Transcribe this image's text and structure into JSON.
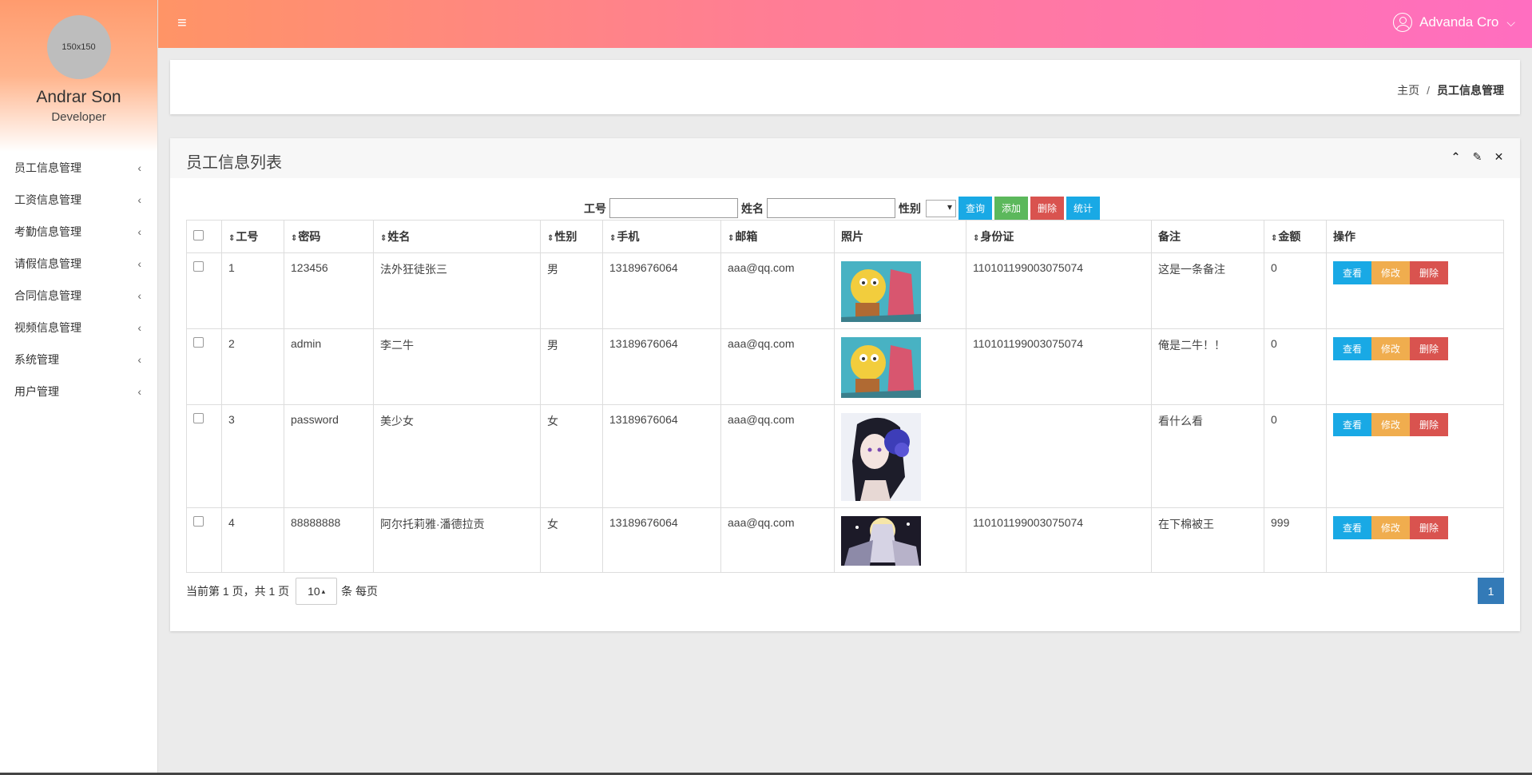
{
  "profile": {
    "avatar_text": "150x150",
    "name": "Andrar Son",
    "role": "Developer"
  },
  "sidebar": {
    "items": [
      {
        "label": "员工信息管理"
      },
      {
        "label": "工资信息管理"
      },
      {
        "label": "考勤信息管理"
      },
      {
        "label": "请假信息管理"
      },
      {
        "label": "合同信息管理"
      },
      {
        "label": "视频信息管理"
      },
      {
        "label": "系统管理"
      },
      {
        "label": "用户管理"
      }
    ],
    "chevron": "‹"
  },
  "topbar": {
    "menu_icon": "≡",
    "user_name": "Advanda Cro",
    "caret": "⌵"
  },
  "breadcrumb": {
    "home": "主页",
    "separator": "/",
    "current": "员工信息管理"
  },
  "panel": {
    "title": "员工信息列表",
    "tools": [
      "⌃",
      "✎",
      "✕"
    ]
  },
  "search": {
    "id_label": "工号",
    "name_label": "姓名",
    "sex_label": "性别",
    "buttons": {
      "query": "查询",
      "add": "添加",
      "delete": "删除",
      "stats": "统计"
    }
  },
  "table": {
    "headers": [
      "工号",
      "密码",
      "姓名",
      "性别",
      "手机",
      "邮箱",
      "照片",
      "身份证",
      "备注",
      "金额",
      "操作"
    ],
    "sort_icon": "⇕",
    "rows": [
      {
        "id": "1",
        "password": "123456",
        "name": "法外狂徒张三",
        "sex": "男",
        "phone": "13189676064",
        "email": "aaa@qq.com",
        "idcard": "110101199003075074",
        "remark": "这是一条备注",
        "amount": "0"
      },
      {
        "id": "2",
        "password": "admin",
        "name": "李二牛",
        "sex": "男",
        "phone": "13189676064",
        "email": "aaa@qq.com",
        "idcard": "110101199003075074",
        "remark": "俺是二牛！！",
        "amount": "0"
      },
      {
        "id": "3",
        "password": "password",
        "name": "美少女",
        "sex": "女",
        "phone": "13189676064",
        "email": "aaa@qq.com",
        "idcard": "",
        "remark": "看什么看",
        "amount": "0"
      },
      {
        "id": "4",
        "password": "88888888",
        "name": "阿尔托莉雅·潘德拉贡",
        "sex": "女",
        "phone": "13189676064",
        "email": "aaa@qq.com",
        "idcard": "110101199003075074",
        "remark": "在下棉被王",
        "amount": "999"
      }
    ],
    "actions": {
      "view": "查看",
      "edit": "修改",
      "delete": "删除"
    }
  },
  "pager": {
    "info": "当前第 1 页，共 1 页",
    "page_size": "10",
    "page_size_caret": "▴",
    "per_page": "条 每页",
    "current_page": "1"
  },
  "colors": {
    "accent_blue": "#19a9e5",
    "green": "#5cb85c",
    "red": "#d9534f",
    "orange": "#f0ad4e",
    "page_blue": "#337ab7"
  }
}
